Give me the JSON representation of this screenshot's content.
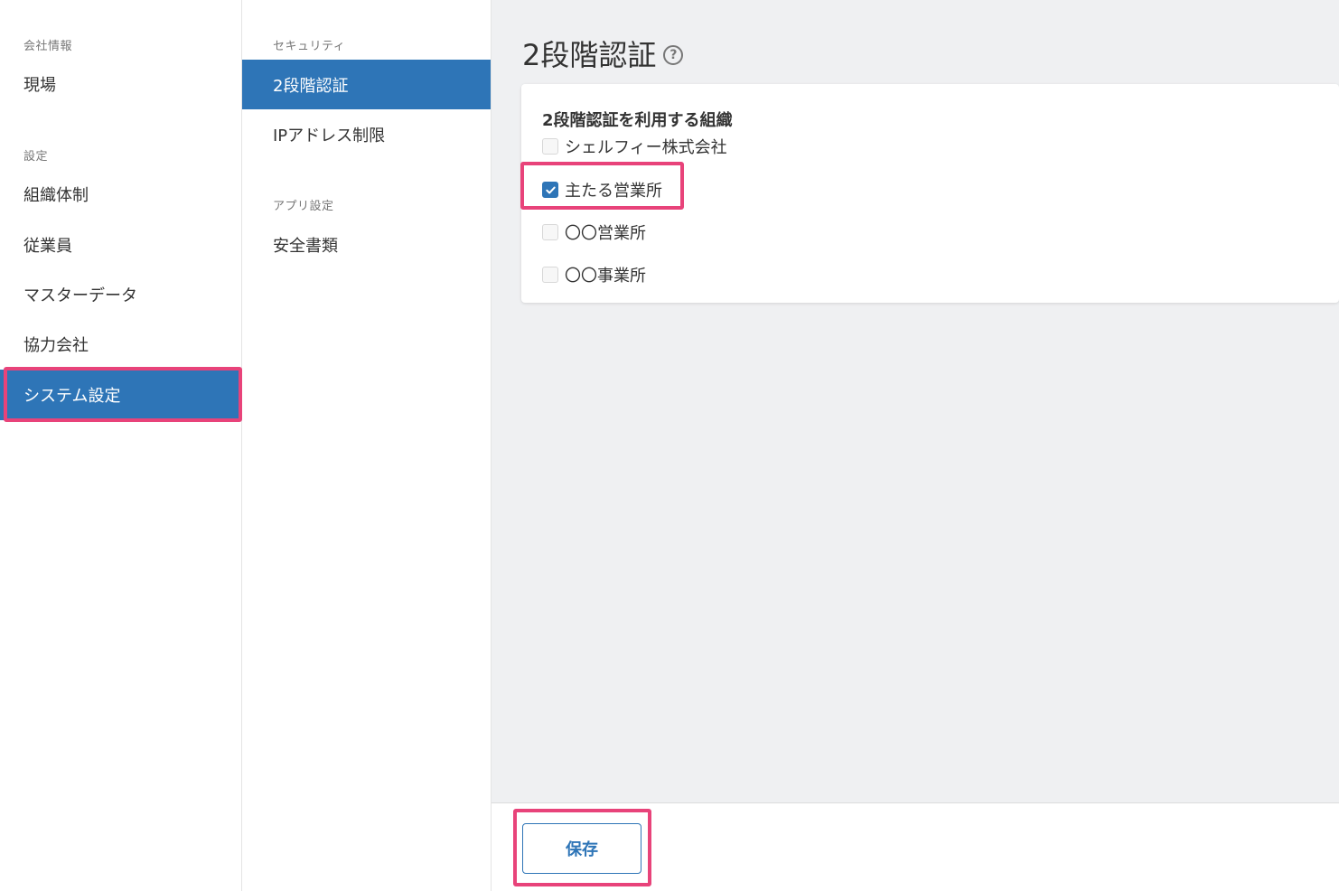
{
  "sidebar": {
    "section_company": "会社情報",
    "item_site": "現場",
    "section_settings": "設定",
    "item_org": "組織体制",
    "item_employees": "従業員",
    "item_master": "マスターデータ",
    "item_partners": "協力会社",
    "item_system": "システム設定"
  },
  "subnav": {
    "section_security": "セキュリティ",
    "item_2fa": "2段階認証",
    "item_ip": "IPアドレス制限",
    "section_app": "アプリ設定",
    "item_safety_docs": "安全書類"
  },
  "main": {
    "title": "2段階認証",
    "help_icon": "question-circle-icon",
    "card_heading": "2段階認証を利用する組織",
    "orgs": [
      {
        "label": "シェルフィー株式会社",
        "checked": false
      },
      {
        "label": "主たる営業所",
        "checked": true
      },
      {
        "label": "〇〇営業所",
        "checked": false
      },
      {
        "label": "〇〇事業所",
        "checked": false
      }
    ]
  },
  "footer": {
    "save_label": "保存"
  },
  "colors": {
    "accent": "#2e75b7",
    "highlight": "#e8437a",
    "main_bg": "#eff0f2"
  }
}
